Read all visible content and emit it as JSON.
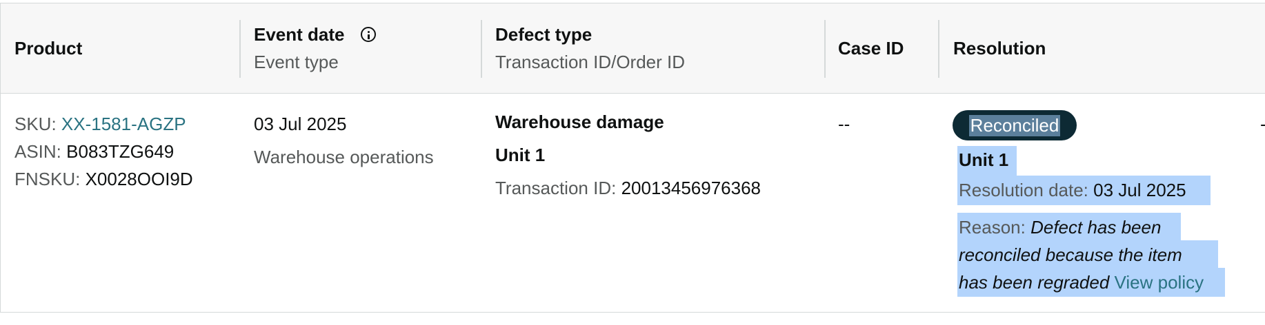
{
  "headers": {
    "product": "Product",
    "event_date": "Event date",
    "event_type": "Event type",
    "defect_type": "Defect type",
    "transaction_order": "Transaction ID/Order ID",
    "case_id": "Case ID",
    "resolution": "Resolution"
  },
  "row": {
    "sku_label": "SKU:",
    "sku_value": "XX-1581-AGZP",
    "asin_label": "ASIN:",
    "asin_value": "B083TZG649",
    "fnsku_label": "FNSKU:",
    "fnsku_value": "X0028OOI9D",
    "event_date": "03 Jul 2025",
    "event_type": "Warehouse operations",
    "defect_type": "Warehouse damage",
    "unit": "Unit 1",
    "transaction_label": "Transaction ID:",
    "transaction_value": "20013456976368",
    "case_id": "--",
    "resolution_badge": "Reconciled",
    "resolution_unit": "Unit 1",
    "resolution_date_label": "Resolution date:",
    "resolution_date_value": "03 Jul 2025",
    "reason_label": "Reason:",
    "reason_line1": "Defect has been",
    "reason_line2": "reconciled because the item",
    "reason_line3": "has been regraded",
    "view_policy": "View policy",
    "trailing_mark": "-"
  },
  "colors": {
    "link": "#2a7382",
    "badge_bg": "#0d2a34",
    "selection": "#b3d4fc",
    "header_bg": "#f7f7f7"
  },
  "icons": {
    "event_date_info": "info-circle-icon"
  }
}
